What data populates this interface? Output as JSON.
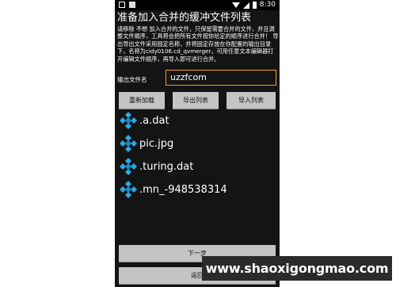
{
  "statusbar": {
    "time": "8:30"
  },
  "title": "准备加入合并的缓冲文件列表",
  "description": "请移除 不想 加入合并的文件，只保留需要合并的文件，并且调整文件顺序，工具将会把所有文件按你给定的顺序进行合并！ 导出导出文件采用固定名称，并将固定存放在你配置的输出目录下，名称为cidy0106.cd_qvmerger，可用任意文本编辑器打开编辑文件顺序，再导入即可进行合并。",
  "output": {
    "label": "输出文件名",
    "value": "uzzfcom"
  },
  "buttons": {
    "reload": "重新加载",
    "export": "导出列表",
    "import": "导入列表",
    "next": "下一步",
    "back": "返回"
  },
  "files": [
    ".a.dat",
    "pic.jpg",
    ".turing.dat",
    ".mn_-948538314"
  ],
  "colors": {
    "accent": "#f0a020",
    "file_icon": "#2ba9e6",
    "background": "#141414"
  },
  "watermark": "www.shaoxigongmao.com"
}
